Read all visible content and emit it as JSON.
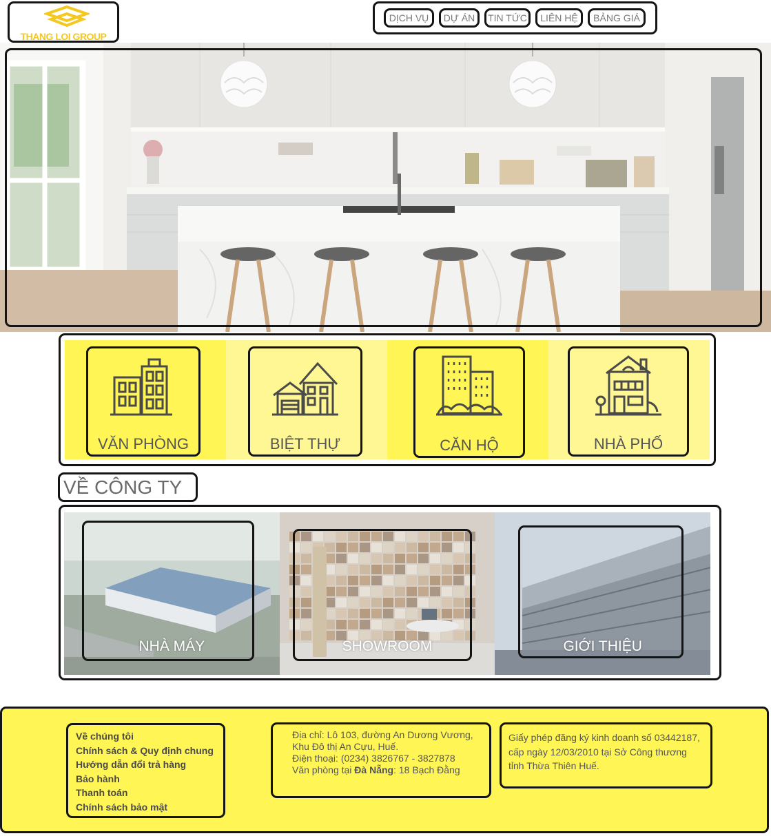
{
  "header": {
    "logo_text": "THANG LOI GROUP",
    "nav": [
      {
        "label": "DỊCH VỤ"
      },
      {
        "label": "DỰ ÁN"
      },
      {
        "label": "TIN TỨC"
      },
      {
        "label": "LIÊN HỆ"
      },
      {
        "label": "BẢNG GIÁ"
      }
    ]
  },
  "categories": [
    {
      "label": "VĂN PHÒNG",
      "icon": "office-building-icon"
    },
    {
      "label": "BIỆT THỰ",
      "icon": "villa-icon"
    },
    {
      "label": "CĂN HỘ",
      "icon": "apartment-icon"
    },
    {
      "label": "NHÀ PHỐ",
      "icon": "townhouse-icon"
    }
  ],
  "about": {
    "title": "VỀ CÔNG TY",
    "items": [
      {
        "label": "NHÀ MÁY"
      },
      {
        "label": "SHOWROOM"
      },
      {
        "label": "GIỚI THIỆU"
      }
    ]
  },
  "footer": {
    "links": [
      "Về chúng tôi",
      "Chính sách & Quy định chung",
      "Hướng dẫn đổi trả hàng",
      "Bảo hành",
      "Thanh toán",
      "Chính sách bảo mật"
    ],
    "address": "Địa chỉ: Lô 103, đường An Dương Vương, Khu Đô thị An Cựu, Huế.",
    "phone": "Điện thoại: (0234) 3826767 - 3827878",
    "office_prefix": "Văn phòng tại ",
    "office_city": "Đà Nẵng",
    "office_address": ": 18 Bạch Đằng",
    "license": "Giấy phép đăng ký kinh doanh số 03442187, cấp ngày 12/03/2010 tại Sở Công thương tỉnh Thừa Thiên Huế."
  },
  "colors": {
    "accent_yellow": "#fff554",
    "accent_yellow_light": "#fff794",
    "logo_gold": "#f4c81f",
    "outline": "#141414"
  }
}
